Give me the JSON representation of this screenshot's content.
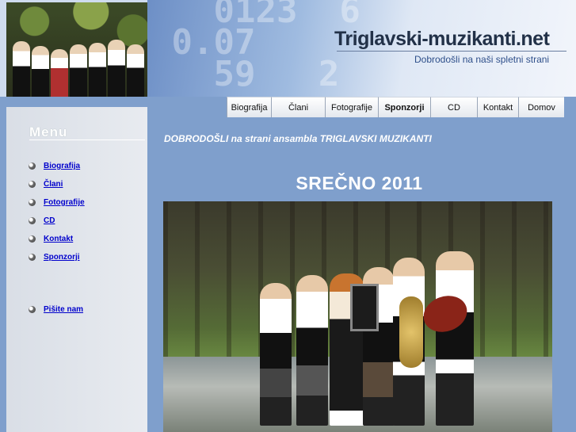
{
  "header": {
    "site_title": "Triglavski-muzikanti.net",
    "subtitle": "Dobrodošli na naši spletni strani"
  },
  "nav": {
    "items": [
      {
        "label": "Biografija"
      },
      {
        "label": "Člani"
      },
      {
        "label": "Fotografije"
      },
      {
        "label": "Sponzorji",
        "active": true
      },
      {
        "label": "CD"
      },
      {
        "label": "Kontakt"
      },
      {
        "label": "Domov"
      }
    ]
  },
  "sidebar": {
    "menu_title": "Menu",
    "items": [
      {
        "label": "Biografija"
      },
      {
        "label": "Člani"
      },
      {
        "label": "Fotografije"
      },
      {
        "label": "CD"
      },
      {
        "label": "Kontakt"
      },
      {
        "label": "Sponzorji"
      }
    ],
    "contact_link": "Pišite nam"
  },
  "main": {
    "welcome": "DOBRODOŠLI na strani ansambla TRIGLAVSKI MUZIKANTI",
    "headline": "SREČNO 2011"
  },
  "colors": {
    "page_bg": "#7f9fcc",
    "link": "#0000cc",
    "sidebar_bg": "#e8ebf0"
  }
}
